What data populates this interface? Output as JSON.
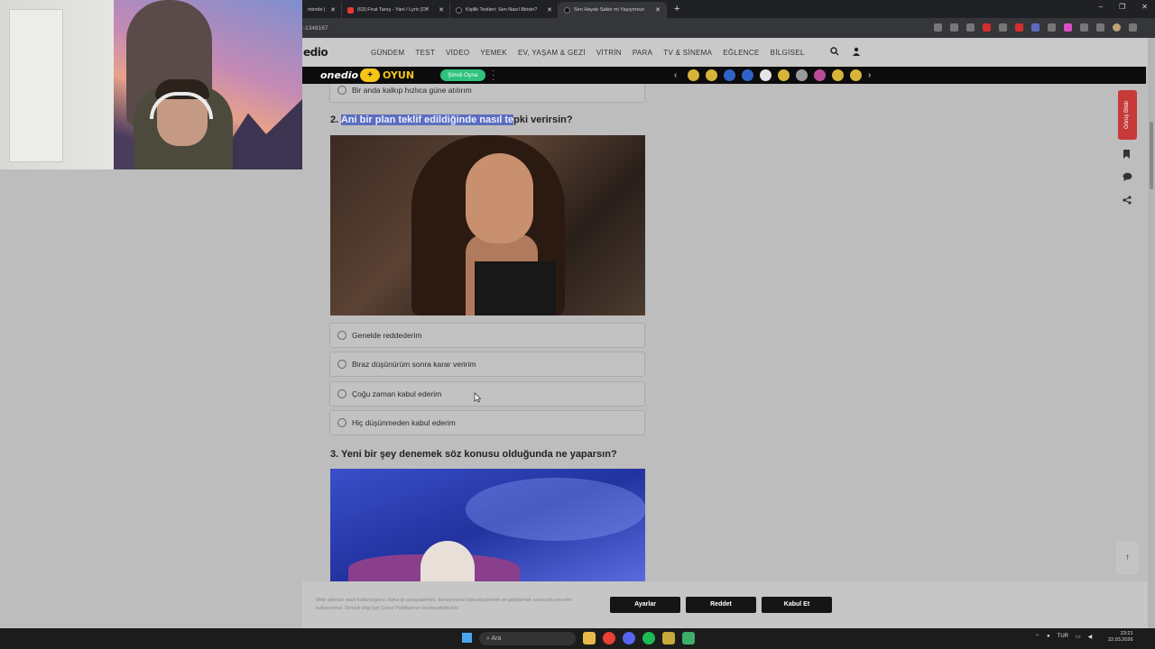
{
  "browser": {
    "tabs": [
      {
        "title": "rtsinde |",
        "icon": "tab-favicon"
      },
      {
        "title": "(63) Fırat Tanış - Yani / Lyric [Off",
        "icon": "youtube-icon"
      },
      {
        "title": "Kişilik Testleri: Sen Nasıl Birisin?",
        "icon": "onedio-icon"
      },
      {
        "title": "Sen Hayatı Sakin mi Yaşıyorsun",
        "icon": "onedio-icon"
      }
    ],
    "new_tab": "+",
    "url": "-1348167",
    "window_controls": [
      "–",
      "❐",
      "✕"
    ]
  },
  "site": {
    "logo": "edio",
    "nav": [
      "GÜNDEM",
      "TEST",
      "VİDEO",
      "YEMEK",
      "EV, YAŞAM & GEZİ",
      "VİTRİN",
      "PARA",
      "TV & SİNEMA",
      "EĞLENCE",
      "BİLGİSEL"
    ],
    "game_logo": "onedio",
    "game_plus": "+",
    "game_word": "OYUN",
    "play_button": "Şimdi Oyna",
    "arrow_left": "‹",
    "arrow_right": "›"
  },
  "quiz": {
    "prev_option": "Bir anda kalkıp hızlıca güne atılırım",
    "q2": {
      "number": "2.",
      "title_highlighted": "Ani bir plan teklif edildiğinde nasıl te",
      "title_rest": "pki verirsin?",
      "options": [
        "Genelde reddederim",
        "Biraz düşünürüm sonra karar veririm",
        "Çoğu zaman kabul ederim",
        "Hiç düşünmeden kabul ederim"
      ]
    },
    "q3": {
      "title": "3. Yeni bir şey denemek söz konusu olduğunda ne yaparsın?"
    }
  },
  "side": {
    "feedback": "Görüş Bildir",
    "to_top": "↑"
  },
  "cookie": {
    "text": "Web sitemizi nasıl kullandığınızı daha iyi anlayabilmek, deneyiminizi kişiselleştirmek ve geliştirmek amacıyla çerezler kullanıyoruz. Detaylı bilgi için Çerez Politikamızı inceleyebilirsiniz.",
    "settings": "Ayarlar",
    "reject": "Reddet",
    "accept": "Kabul Et"
  },
  "taskbar": {
    "search_placeholder": "Ara",
    "lang": "TUR",
    "time": "23:21",
    "date": "22.03.2026"
  },
  "colors": {
    "highlight": "#5b6fbf",
    "game_accent": "#f5c518",
    "play_green": "#2ec27e",
    "feedback_red": "#c63a3a"
  }
}
